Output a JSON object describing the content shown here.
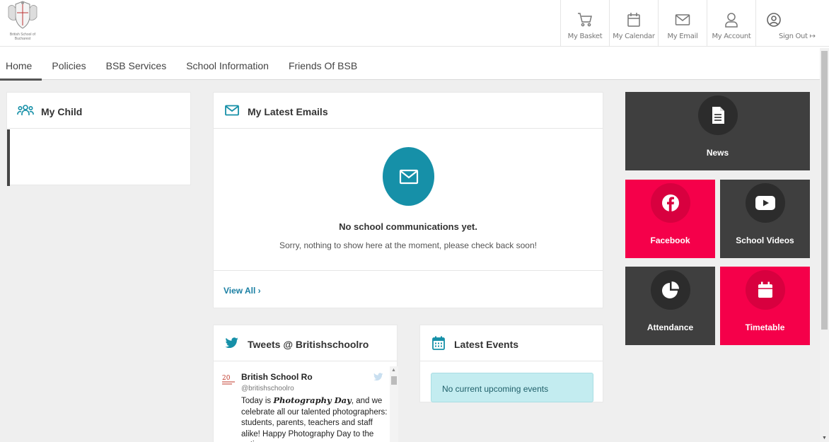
{
  "logo": {
    "text": "British School of Bucharest"
  },
  "toplinks": [
    {
      "label": "My Basket",
      "icon": "basket-icon"
    },
    {
      "label": "My Calendar",
      "icon": "calendar-icon"
    },
    {
      "label": "My Email",
      "icon": "email-icon"
    },
    {
      "label": "My Account",
      "icon": "user-icon"
    },
    {
      "label": "Sign Out",
      "icon": "sign-out-icon"
    }
  ],
  "nav": [
    "Home",
    "Policies",
    "BSB Services",
    "School Information",
    "Friends Of BSB"
  ],
  "my_child": {
    "title": "My Child"
  },
  "emails": {
    "title": "My Latest Emails",
    "empty_title": "No school communications yet.",
    "empty_sub": "Sorry, nothing to show here at the moment, please check back soon!",
    "view_all": "View All ›"
  },
  "tweets": {
    "title": "Tweets @ Britishschoolro",
    "name": "British School Ro",
    "handle": "@britishschoolro",
    "text_before": "Today is ",
    "text_em": "Photography Day",
    "text_after": ", and we celebrate all our talented photographers: students, parents, teachers and staff alike! Happy Photography Day to the entire"
  },
  "events": {
    "title": "Latest Events",
    "empty": "No current upcoming events"
  },
  "tiles": {
    "news": "News",
    "facebook": "Facebook",
    "videos": "School Videos",
    "attendance": "Attendance",
    "timetable": "Timetable"
  },
  "colors": {
    "accent": "#1690a8",
    "pink": "#f5004a",
    "dark_tile": "#3f3f3f",
    "alert_bg": "#c3ecf0"
  }
}
